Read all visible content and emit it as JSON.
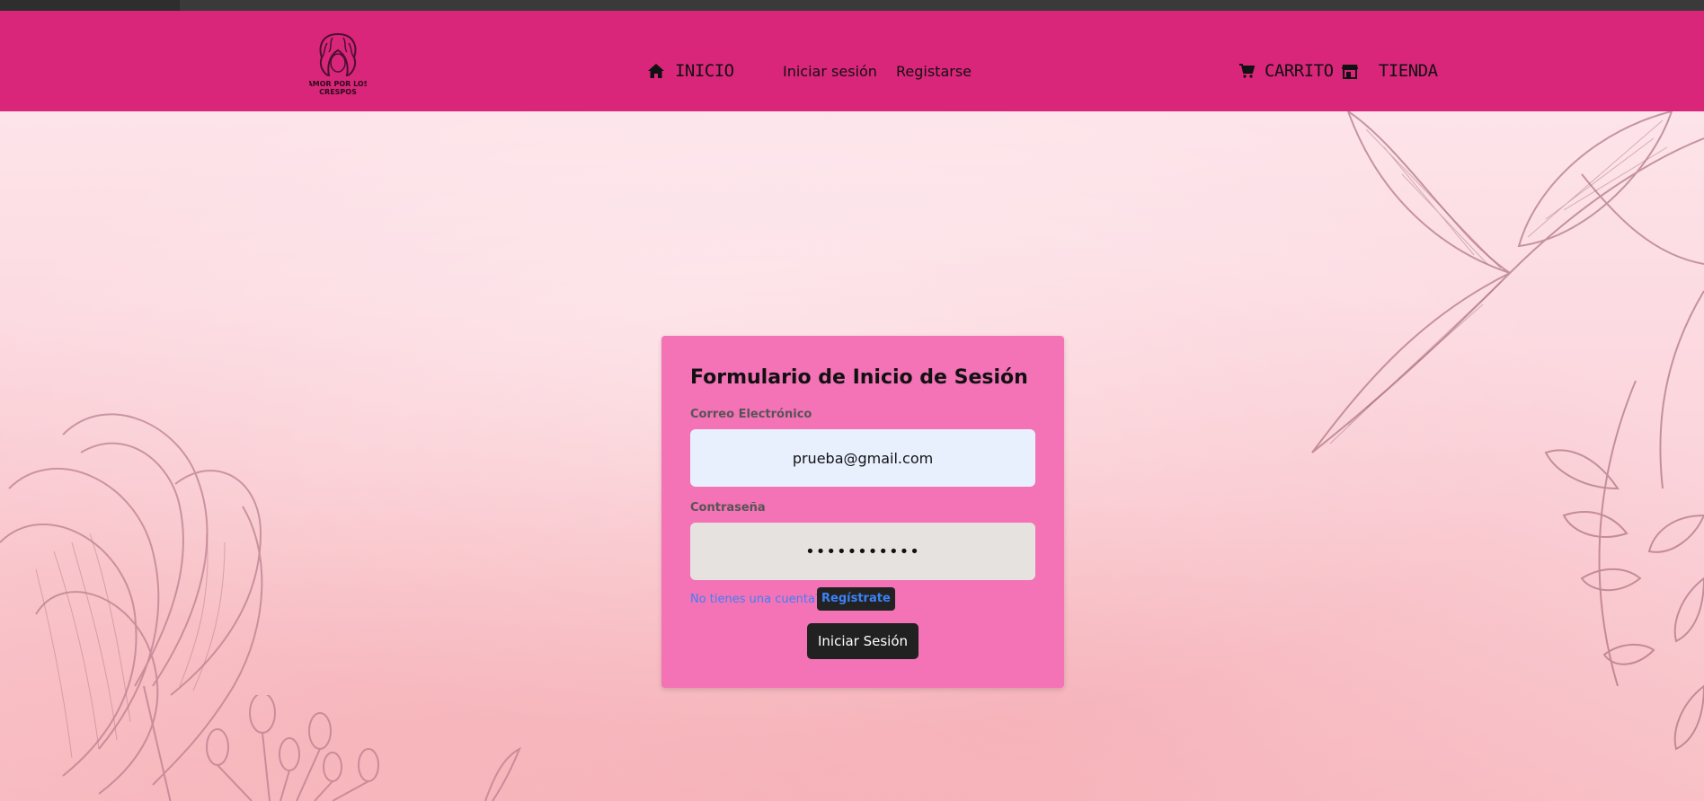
{
  "header": {
    "logo_text": "AMOR POR LOS CRESPOS",
    "nav": {
      "home": "INICIO",
      "login": "Iniciar sesión",
      "register": "Registarse",
      "cart": "CARRITO",
      "store": "TIENDA"
    }
  },
  "form": {
    "title": "Formulario de Inicio de Sesión",
    "email_label": "Correo Electrónico",
    "email_value": "prueba@gmail.com",
    "password_label": "Contraseña",
    "password_value": "prueba12345",
    "no_account_text": "No tienes una cuenta?",
    "register_link": "Regístrate",
    "submit_label": "Iniciar Sesión"
  },
  "icons": {
    "home": "home-icon",
    "cart": "cart-icon",
    "store": "store-icon"
  },
  "colors": {
    "navbar": "#d9267b",
    "card": "#f472b6",
    "button": "#212121",
    "link": "#3b82f6"
  }
}
